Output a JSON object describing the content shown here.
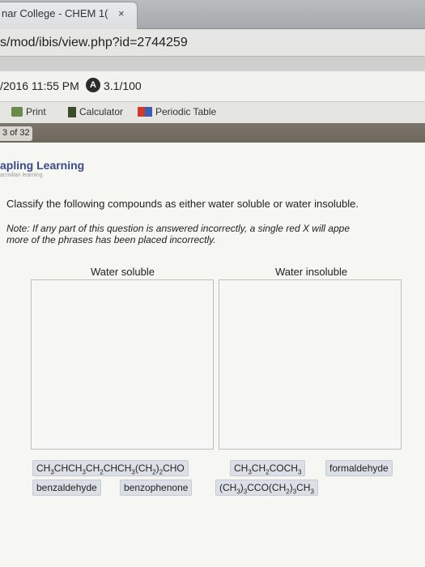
{
  "browser": {
    "tab_title": "nar College - CHEM 1(",
    "tab_close": "×",
    "url": "s/mod/ibis/view.php?id=2744259"
  },
  "assignment": {
    "due": "/2016 11:55 PM",
    "score_badge": "A",
    "score": "3.1/100"
  },
  "toolbar": {
    "print_label": "Print",
    "calculator_label": "Calculator",
    "periodic_table_label": "Periodic Table"
  },
  "pager": {
    "count": "3 of 32"
  },
  "brand": {
    "name": "apling Learning",
    "sub": "acmillan learning"
  },
  "question": {
    "prompt": "Classify the following compounds as either water soluble or water insoluble.",
    "note_line1": "Note: If any part of this question is answered incorrectly, a single red X will appe",
    "note_line2": "more of the phrases has been placed incorrectly."
  },
  "columns": {
    "soluble": "Water soluble",
    "insoluble": "Water insoluble"
  },
  "compounds": [
    "CH3CHCH3CH2CHCH3(CH2)2CHO",
    "CH3CH2COCH3",
    "formaldehyde",
    "benzaldehyde",
    "benzophenone",
    "(CH3)3CCO(CH2)3CH3"
  ],
  "colors": {
    "brand": "#3b4b8a",
    "chip_bg": "#dcdfe6"
  }
}
